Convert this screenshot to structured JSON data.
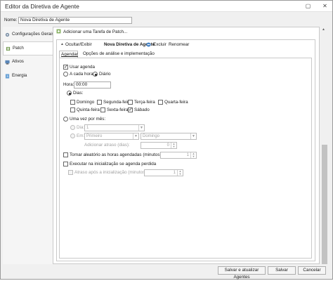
{
  "window": {
    "title": "Editor da Diretiva de Agente"
  },
  "name_field": {
    "label": "Nome:",
    "value": "Nova Diretiva de Agente"
  },
  "nav": {
    "items": [
      {
        "label": "Configurações Gerais",
        "icon": "gear-icon"
      },
      {
        "label": "Patch",
        "icon": "patch-icon"
      },
      {
        "label": "Ativos",
        "icon": "assets-icon"
      },
      {
        "label": "Energia",
        "icon": "power-icon"
      }
    ]
  },
  "task": {
    "add_label": "Adicionar uma Tarefa de Patch...",
    "toggle_label": "Ocultar/Exibir",
    "name": "Nova Diretiva de Agente",
    "delete_label": "Excluir",
    "rename_label": "Renomear"
  },
  "tabs": {
    "schedule": "Agendar",
    "options": "Opções de análise e implementação"
  },
  "schedule": {
    "use_label": "Usar agenda",
    "hourly_label": "A cada hora",
    "daily_label": "Diário",
    "time_label": "Hora:",
    "time_value": "00:00",
    "days_label": "Dias:",
    "days": {
      "mon": "Segunda-feira",
      "tue": "Terça-feira",
      "wed": "Quarta-feira",
      "thu": "Quinta-feira",
      "fri": "Sexta-feira",
      "sat": "Sábado",
      "sun": "Domingo"
    },
    "monthly_label": "Uma vez por mês:",
    "day_label": "Dia:",
    "day_value": "1",
    "on_label": "Em:",
    "on_value": "Primeiro",
    "on_day_value": "Domingo",
    "delay_label": "Adicionar atraso (dias):",
    "delay_value": "0",
    "random_label": "Tornar aleatório as horas agendadas (minutos)",
    "random_value": "1",
    "startup_label": "Executar na inicialização se agenda perdida",
    "startup_delay_label": "Atraso após a inicialização (minutos)",
    "startup_delay_value": "1"
  },
  "footer": {
    "save_update": "Salvar e atualizar Agentes",
    "save": "Salvar",
    "cancel": "Cancelar"
  }
}
